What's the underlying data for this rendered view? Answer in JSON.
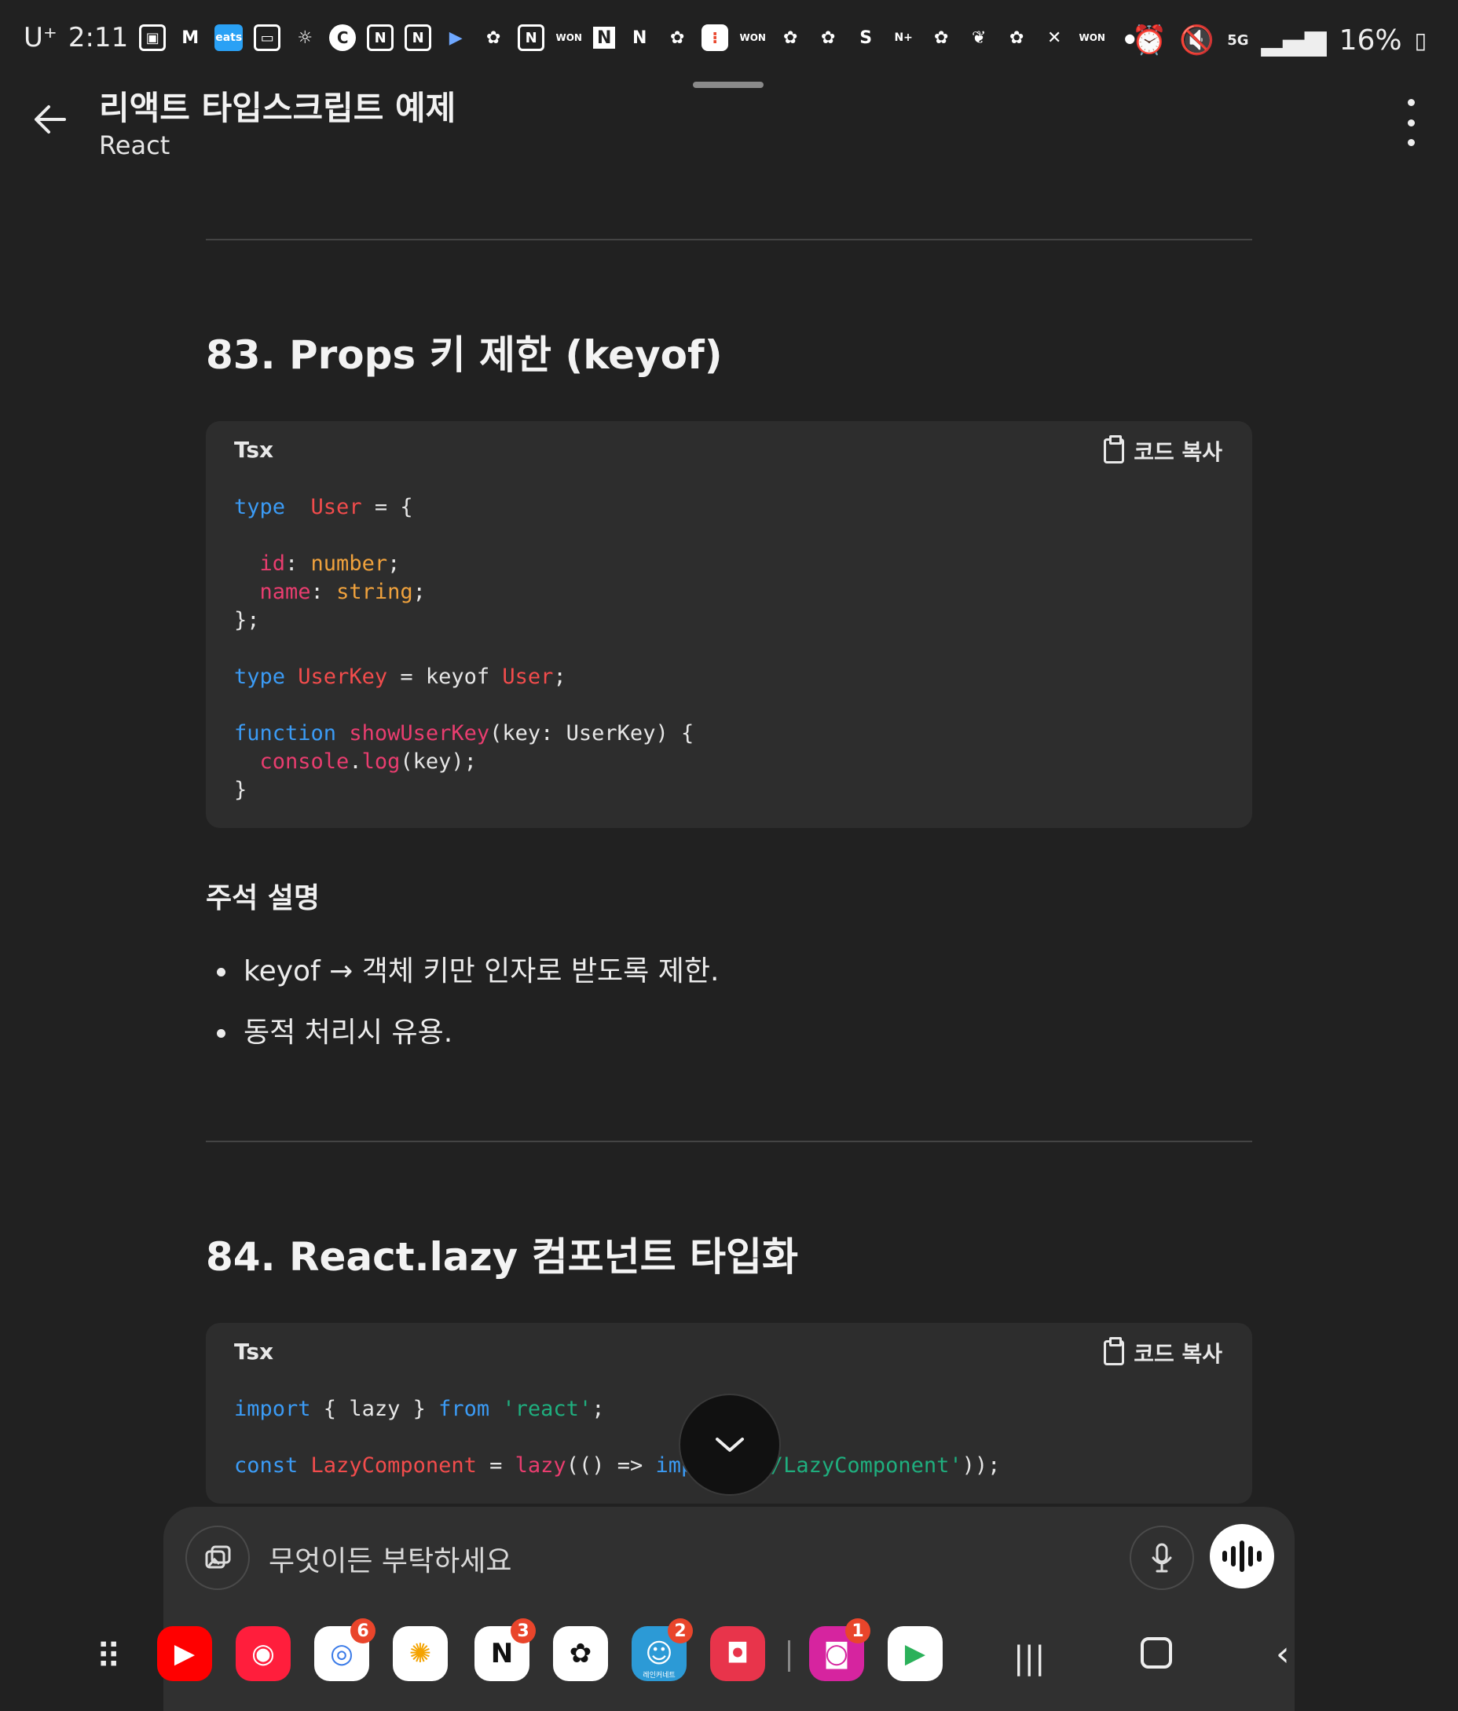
{
  "status_bar": {
    "carrier": "U⁺",
    "time": "2:11",
    "battery": "16%",
    "notification_icons": [
      "gallery-icon",
      "gmail-icon",
      "eats-icon",
      "tv-icon",
      "brightness-icon",
      "c-app-icon",
      "notion-icon",
      "notion-icon",
      "play-icon",
      "chatgpt-icon",
      "notion-icon",
      "won-icon",
      "n-app-icon",
      "netflix-icon",
      "chatgpt-icon",
      "todo-icon",
      "won-icon",
      "chatgpt-icon",
      "chatgpt-icon",
      "s-app-icon",
      "naver-plus-icon",
      "chatgpt-icon",
      "perplexity-icon",
      "chatgpt-icon",
      "x-icon",
      "won-icon"
    ],
    "eats_label": "eats",
    "won_label": "WON",
    "n_plus_label": "N+"
  },
  "app_bar": {
    "title": "리액트 타입스크립트 예제",
    "subtitle": "React"
  },
  "sections": [
    {
      "heading": "83. Props 키 제한 (keyof)",
      "code_lang": "Tsx",
      "copy_label": "코드 복사",
      "annotation_title": "주석 설명",
      "bullets": [
        "keyof → 객체 키만 인자로 받도록 제한.",
        "동적 처리시 유용."
      ]
    },
    {
      "heading": "84. React.lazy 컴포넌트 타입화",
      "code_lang": "Tsx",
      "copy_label": "코드 복사"
    }
  ],
  "code1": [
    [
      [
        "k",
        "type"
      ],
      [
        "",
        "  "
      ],
      [
        "t",
        "User"
      ],
      [
        "",
        " = {"
      ]
    ],
    [
      [
        "",
        ""
      ]
    ],
    [
      [
        "",
        "  "
      ],
      [
        "p",
        "id"
      ],
      [
        "",
        ": "
      ],
      [
        "s",
        "number"
      ],
      [
        "",
        ";"
      ]
    ],
    [
      [
        "",
        "  "
      ],
      [
        "p",
        "name"
      ],
      [
        "",
        ": "
      ],
      [
        "s",
        "string"
      ],
      [
        "",
        ";"
      ]
    ],
    [
      [
        "",
        "};"
      ]
    ],
    [
      [
        "",
        ""
      ]
    ],
    [
      [
        "k",
        "type"
      ],
      [
        "",
        " "
      ],
      [
        "t",
        "UserKey"
      ],
      [
        "",
        " = keyof "
      ],
      [
        "t",
        "User"
      ],
      [
        "",
        ";"
      ]
    ],
    [
      [
        "",
        ""
      ]
    ],
    [
      [
        "k",
        "function"
      ],
      [
        "",
        " "
      ],
      [
        "p",
        "showUserKey"
      ],
      [
        "",
        "(key: UserKey) {"
      ]
    ],
    [
      [
        "",
        "  "
      ],
      [
        "p",
        "console"
      ],
      [
        "",
        "."
      ],
      [
        "p",
        "log"
      ],
      [
        "",
        "(key);"
      ]
    ],
    [
      [
        "",
        "}"
      ]
    ]
  ],
  "code2": [
    [
      [
        "k",
        "import"
      ],
      [
        "",
        " { lazy } "
      ],
      [
        "k",
        "from"
      ],
      [
        "",
        " "
      ],
      [
        "str",
        "'react'"
      ],
      [
        "",
        ";"
      ]
    ],
    [
      [
        "",
        ""
      ]
    ],
    [
      [
        "k",
        "const"
      ],
      [
        "",
        " "
      ],
      [
        "t",
        "LazyComponent"
      ],
      [
        "",
        " = "
      ],
      [
        "p",
        "lazy"
      ],
      [
        "",
        "(() => "
      ],
      [
        "k",
        "import"
      ],
      [
        "",
        "("
      ],
      [
        "str",
        "'./LazyComponent'"
      ],
      [
        "",
        "));"
      ]
    ]
  ],
  "composer": {
    "placeholder": "무엇이든 부탁하세요"
  },
  "taskbar": {
    "apps": [
      {
        "name": "youtube-icon",
        "color": "#ff0000",
        "badge": ""
      },
      {
        "name": "youtube-music-icon",
        "color": "#ff1e3c",
        "badge": ""
      },
      {
        "name": "chrome-icon",
        "color": "#ffffff",
        "badge": "6"
      },
      {
        "name": "google-photos-icon",
        "color": "#ffffff",
        "badge": ""
      },
      {
        "name": "notion-icon",
        "color": "#ffffff",
        "badge": "3"
      },
      {
        "name": "chatgpt-icon",
        "color": "#ffffff",
        "badge": ""
      },
      {
        "name": "game-app-icon",
        "color": "#2c9ad6",
        "badge": "2"
      },
      {
        "name": "camera-icon",
        "color": "#e8344b",
        "badge": ""
      },
      {
        "name": "instagram-icon",
        "color": "#d6249f",
        "badge": "1"
      },
      {
        "name": "play-store-icon",
        "color": "#ffffff",
        "badge": ""
      }
    ],
    "game_app_label": "레인커네트"
  }
}
